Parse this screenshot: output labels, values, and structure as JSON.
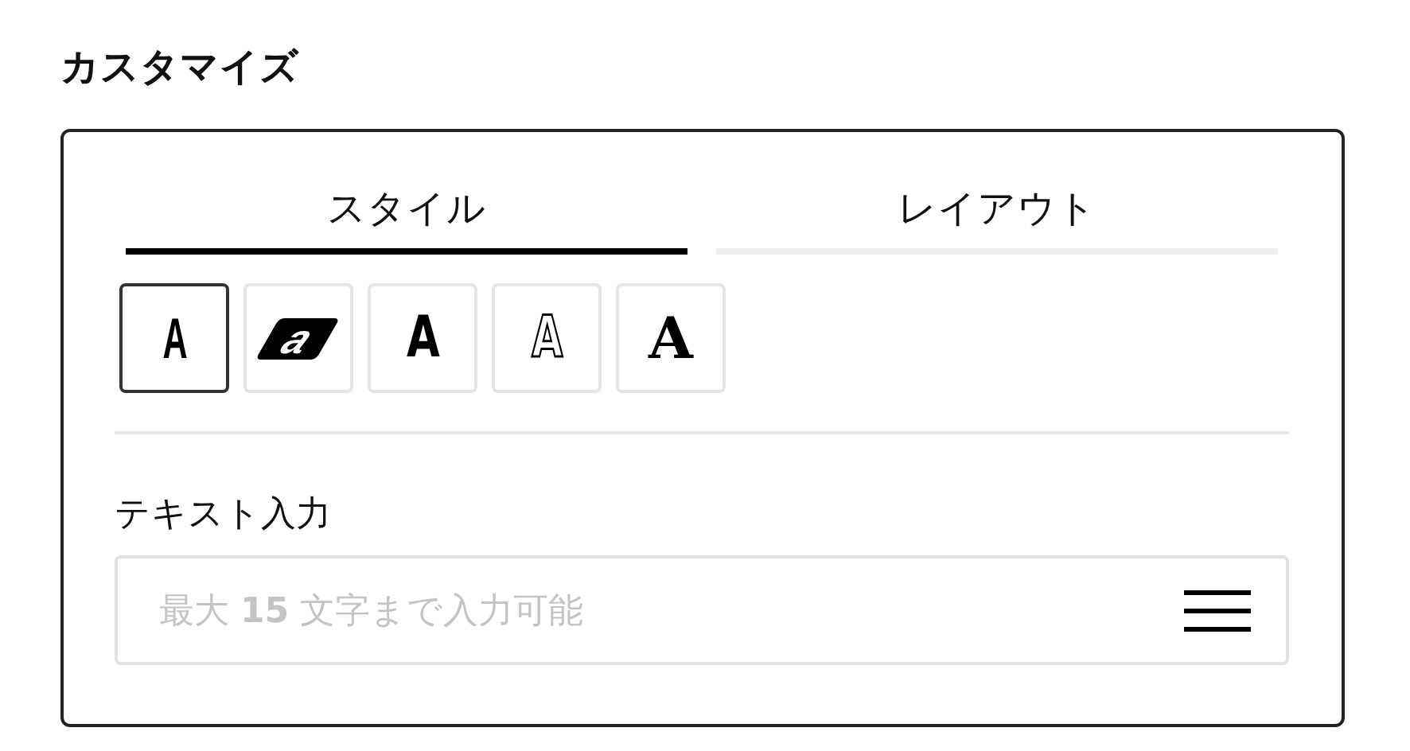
{
  "title": "カスタマイズ",
  "tabs": [
    {
      "label": "スタイル",
      "selected": true
    },
    {
      "label": "レイアウト",
      "selected": false
    }
  ],
  "font_styles": [
    {
      "kind": "condensed",
      "label": "A",
      "selected": true
    },
    {
      "kind": "slanted",
      "label": "a",
      "selected": false
    },
    {
      "kind": "heavy",
      "label": "A",
      "selected": false
    },
    {
      "kind": "outline",
      "label": "A",
      "selected": false
    },
    {
      "kind": "serif",
      "label": "A",
      "selected": false
    }
  ],
  "text_input": {
    "label": "テキスト入力",
    "placeholder": "最大 **15** 文字まで入力可能"
  }
}
